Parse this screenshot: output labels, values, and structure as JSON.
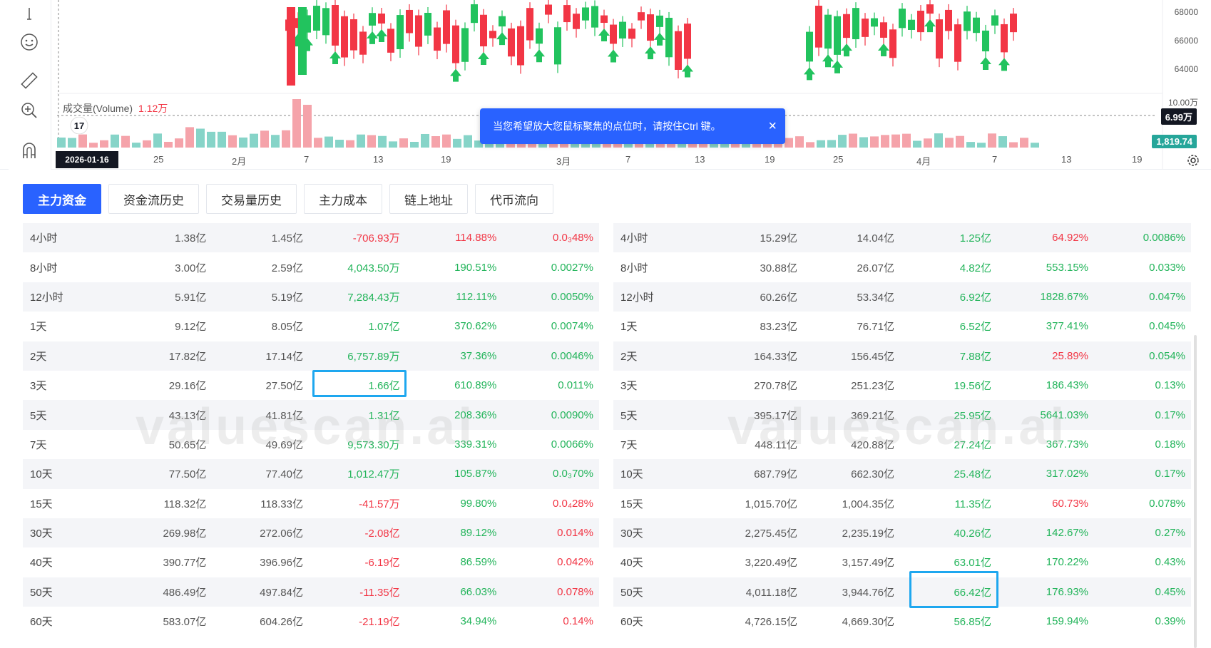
{
  "chart": {
    "volume_label": "成交量(Volume)",
    "volume_value": "1.12万",
    "tv_logo": "17",
    "price_axis": [
      "68000",
      "66000",
      "64000"
    ],
    "volume_axis_top": "10.00万",
    "volume_tag": "6.99万",
    "volume_tag2": "1,819.74",
    "cursor_date": "2026-01-16",
    "date_axis": [
      "25",
      "2月",
      "7",
      "13",
      "19",
      "3月",
      "7",
      "13",
      "19",
      "25",
      "4月",
      "7",
      "13",
      "19"
    ],
    "colors": {
      "up": "#26a69a",
      "down": "#f23645",
      "up_strong": "#22c35e",
      "accent": "#2962ff"
    },
    "icons": [
      "cursor-icon",
      "emoji-icon",
      "ruler-icon",
      "zoom-in-icon",
      "magnet-icon",
      "settings-icon"
    ]
  },
  "tooltip": {
    "text": "当您希望放大您鼠标聚焦的点位时，请按住Ctrl 键。",
    "close": "×"
  },
  "tabs": [
    "主力资金",
    "资金流历史",
    "交易量历史",
    "主力成本",
    "链上地址",
    "代币流向"
  ],
  "table_left": [
    [
      "4小时",
      "1.38亿",
      "1.45亿",
      "-706.93万",
      "114.88%",
      "0.0₃48%"
    ],
    [
      "8小时",
      "3.00亿",
      "2.59亿",
      "4,043.50万",
      "190.51%",
      "0.0027%"
    ],
    [
      "12小时",
      "5.91亿",
      "5.19亿",
      "7,284.43万",
      "112.11%",
      "0.0050%"
    ],
    [
      "1天",
      "9.12亿",
      "8.05亿",
      "1.07亿",
      "370.62%",
      "0.0074%"
    ],
    [
      "2天",
      "17.82亿",
      "17.14亿",
      "6,757.89万",
      "37.36%",
      "0.0046%"
    ],
    [
      "3天",
      "29.16亿",
      "27.50亿",
      "1.66亿",
      "610.89%",
      "0.011%"
    ],
    [
      "5天",
      "43.13亿",
      "41.81亿",
      "1.31亿",
      "208.36%",
      "0.0090%"
    ],
    [
      "7天",
      "50.65亿",
      "49.69亿",
      "9,573.30万",
      "339.31%",
      "0.0066%"
    ],
    [
      "10天",
      "77.50亿",
      "77.40亿",
      "1,012.47万",
      "105.87%",
      "0.0₃70%"
    ],
    [
      "15天",
      "118.32亿",
      "118.33亿",
      "-41.57万",
      "99.80%",
      "0.0₄28%"
    ],
    [
      "30天",
      "269.98亿",
      "272.06亿",
      "-2.08亿",
      "89.12%",
      "0.014%"
    ],
    [
      "40天",
      "390.77亿",
      "396.96亿",
      "-6.19亿",
      "86.59%",
      "0.042%"
    ],
    [
      "50天",
      "486.49亿",
      "497.84亿",
      "-11.35亿",
      "66.03%",
      "0.078%"
    ],
    [
      "60天",
      "583.07亿",
      "604.26亿",
      "-21.19亿",
      "34.94%",
      "0.14%"
    ]
  ],
  "table_left_colors": [
    [
      "red",
      "red",
      "red"
    ],
    [
      "green",
      "green",
      "green"
    ],
    [
      "green",
      "green",
      "green"
    ],
    [
      "green",
      "green",
      "green"
    ],
    [
      "green",
      "green",
      "green"
    ],
    [
      "green",
      "green",
      "green"
    ],
    [
      "green",
      "green",
      "green"
    ],
    [
      "green",
      "green",
      "green"
    ],
    [
      "green",
      "green",
      "green"
    ],
    [
      "red",
      "green",
      "red"
    ],
    [
      "red",
      "green",
      "red"
    ],
    [
      "red",
      "green",
      "red"
    ],
    [
      "red",
      "green",
      "red"
    ],
    [
      "red",
      "green",
      "red"
    ]
  ],
  "table_right": [
    [
      "4小时",
      "15.29亿",
      "14.04亿",
      "1.25亿",
      "64.92%",
      "0.0086%"
    ],
    [
      "8小时",
      "30.88亿",
      "26.07亿",
      "4.82亿",
      "553.15%",
      "0.033%"
    ],
    [
      "12小时",
      "60.26亿",
      "53.34亿",
      "6.92亿",
      "1828.67%",
      "0.047%"
    ],
    [
      "1天",
      "83.23亿",
      "76.71亿",
      "6.52亿",
      "377.41%",
      "0.045%"
    ],
    [
      "2天",
      "164.33亿",
      "156.45亿",
      "7.88亿",
      "25.89%",
      "0.054%"
    ],
    [
      "3天",
      "270.78亿",
      "251.23亿",
      "19.56亿",
      "186.43%",
      "0.13%"
    ],
    [
      "5天",
      "395.17亿",
      "369.21亿",
      "25.95亿",
      "5641.03%",
      "0.17%"
    ],
    [
      "7天",
      "448.11亿",
      "420.88亿",
      "27.24亿",
      "367.73%",
      "0.18%"
    ],
    [
      "10天",
      "687.79亿",
      "662.30亿",
      "25.48亿",
      "317.02%",
      "0.17%"
    ],
    [
      "15天",
      "1,015.70亿",
      "1,004.35亿",
      "11.35亿",
      "60.73%",
      "0.078%"
    ],
    [
      "30天",
      "2,275.45亿",
      "2,235.19亿",
      "40.26亿",
      "142.67%",
      "0.27%"
    ],
    [
      "40天",
      "3,220.49亿",
      "3,157.49亿",
      "63.01亿",
      "170.22%",
      "0.43%"
    ],
    [
      "50天",
      "4,011.18亿",
      "3,944.76亿",
      "66.42亿",
      "176.93%",
      "0.45%"
    ],
    [
      "60天",
      "4,726.15亿",
      "4,669.30亿",
      "56.85亿",
      "159.94%",
      "0.39%"
    ]
  ],
  "table_right_colors": [
    [
      "green",
      "red",
      "green"
    ],
    [
      "green",
      "green",
      "green"
    ],
    [
      "green",
      "green",
      "green"
    ],
    [
      "green",
      "green",
      "green"
    ],
    [
      "green",
      "red",
      "green"
    ],
    [
      "green",
      "green",
      "green"
    ],
    [
      "green",
      "green",
      "green"
    ],
    [
      "green",
      "green",
      "green"
    ],
    [
      "green",
      "green",
      "green"
    ],
    [
      "green",
      "red",
      "green"
    ],
    [
      "green",
      "green",
      "green"
    ],
    [
      "green",
      "green",
      "green"
    ],
    [
      "green",
      "green",
      "green"
    ],
    [
      "green",
      "green",
      "green"
    ]
  ],
  "watermark": "valuescan.ai"
}
